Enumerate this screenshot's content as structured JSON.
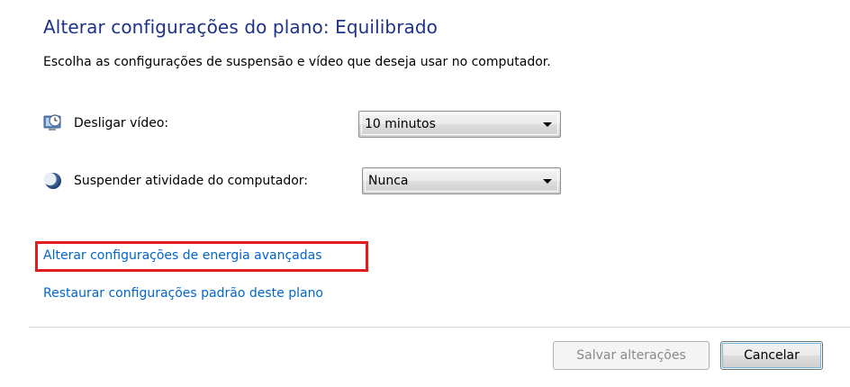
{
  "header": {
    "title": "Alterar configurações do plano: Equilibrado",
    "subtitle": "Escolha as configurações de suspensão e vídeo que deseja usar no computador."
  },
  "settings": {
    "display_off": {
      "label": "Desligar vídeo:",
      "icon": "monitor-clock-icon",
      "selected": "10 minutos"
    },
    "sleep": {
      "label": "Suspender atividade do computador:",
      "icon": "moon-icon",
      "selected": "Nunca"
    }
  },
  "links": {
    "advanced": "Alterar configurações de energia avançadas",
    "restore": "Restaurar configurações padrão deste plano"
  },
  "buttons": {
    "save": "Salvar alterações",
    "cancel": "Cancelar"
  },
  "colors": {
    "title": "#1e3287",
    "link": "#0066cc",
    "highlight": "#e21b1b"
  }
}
